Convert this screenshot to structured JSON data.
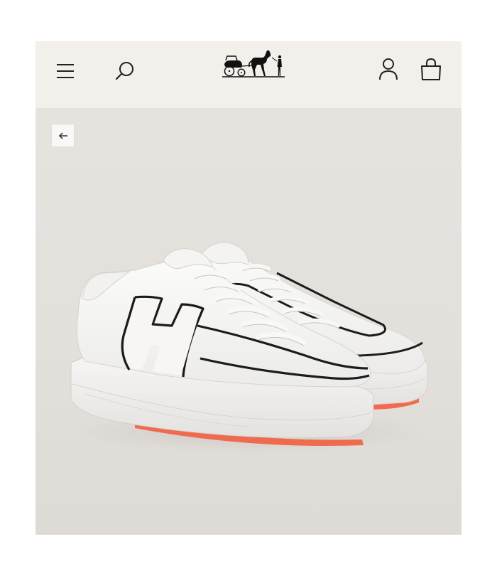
{
  "header": {
    "menu_icon": "hamburger-menu-icon",
    "search_icon": "search-icon",
    "logo": "carriage-logo",
    "account_icon": "user-icon",
    "bag_icon": "shopping-bag-icon",
    "background_color": "#f3efea"
  },
  "gallery": {
    "back_icon": "arrow-left-icon",
    "product_image": "white-leather-sneakers-with-black-h-outline",
    "background_color": "#e4e1dd",
    "sole_accent_color": "#f06a4e"
  }
}
